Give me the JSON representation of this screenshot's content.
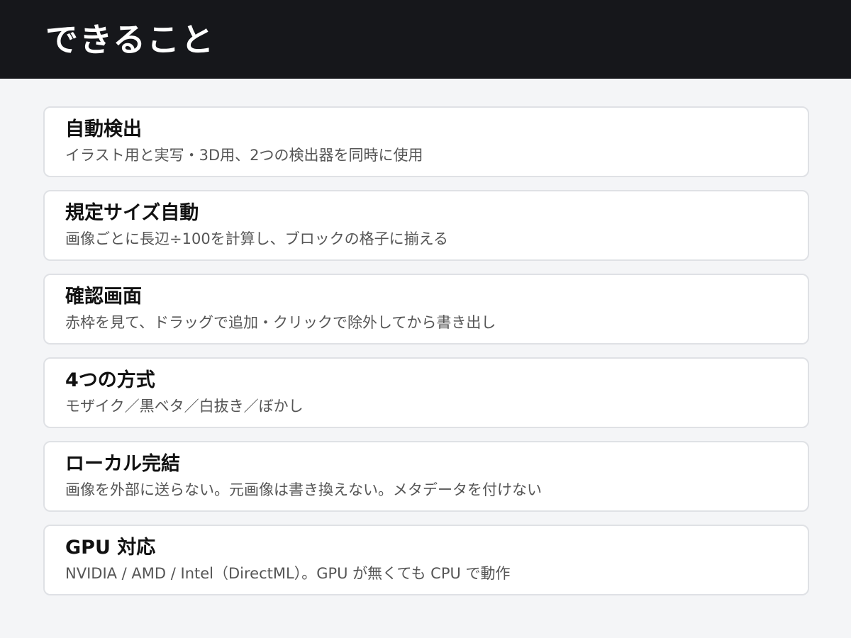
{
  "header": {
    "title": "できること"
  },
  "features": [
    {
      "title": "自動検出",
      "description": "イラスト用と実写・3D用、2つの検出器を同時に使用"
    },
    {
      "title": "規定サイズ自動",
      "description": "画像ごとに長辺÷100を計算し、ブロックの格子に揃える"
    },
    {
      "title": "確認画面",
      "description": "赤枠を見て、ドラッグで追加・クリックで除外してから書き出し"
    },
    {
      "title": "4つの方式",
      "description": "モザイク／黒ベタ／白抜き／ぼかし"
    },
    {
      "title": "ローカル完結",
      "description": "画像を外部に送らない。元画像は書き換えない。メタデータを付けない"
    },
    {
      "title": "GPU 対応",
      "description": "NVIDIA / AMD / Intel（DirectML）。GPU が無くても CPU で動作"
    }
  ]
}
